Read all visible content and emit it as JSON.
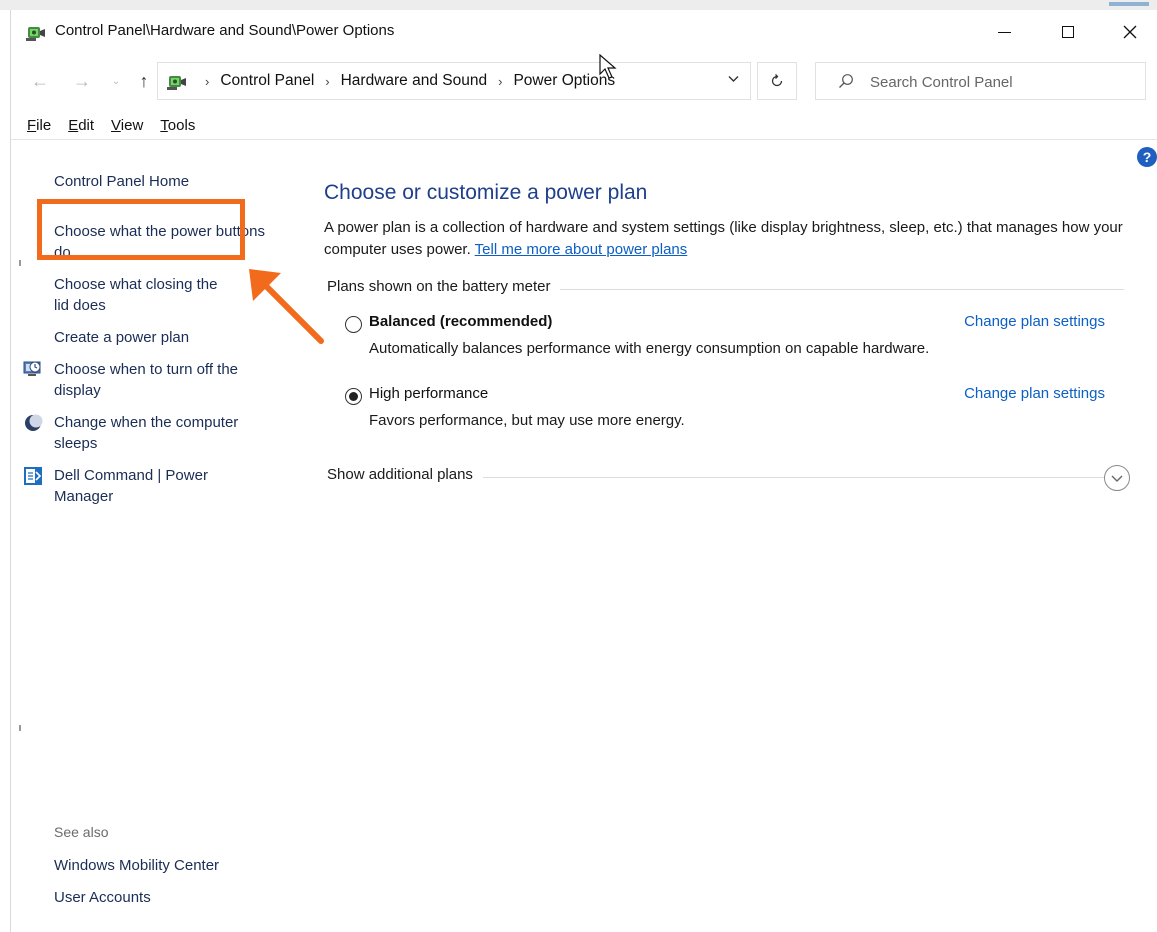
{
  "window": {
    "title": "Control Panel\\Hardware and Sound\\Power Options",
    "minimize_label": "Minimize",
    "maximize_label": "Maximize",
    "close_label": "Close"
  },
  "address": {
    "crumbs": [
      "Control Panel",
      "Hardware and Sound",
      "Power Options"
    ],
    "search_placeholder": "Search Control Panel"
  },
  "menu": {
    "items": [
      {
        "label": "File",
        "accel": "F",
        "rest": "ile"
      },
      {
        "label": "Edit",
        "accel": "E",
        "rest": "dit"
      },
      {
        "label": "View",
        "accel": "V",
        "rest": "iew"
      },
      {
        "label": "Tools",
        "accel": "T",
        "rest": "ools"
      }
    ]
  },
  "sidebar": {
    "home": "Control Panel Home",
    "links": [
      {
        "label": "Choose what the power buttons do",
        "icon": ""
      },
      {
        "label": "Choose what closing the lid does",
        "icon": ""
      },
      {
        "label": "Create a power plan",
        "icon": ""
      },
      {
        "label": "Choose when to turn off the display",
        "icon": "monitor-clock-icon"
      },
      {
        "label": "Change when the computer sleeps",
        "icon": "moon-icon"
      },
      {
        "label": "Dell Command | Power Manager",
        "icon": "dell-power-manager-icon"
      }
    ],
    "see_also_label": "See also",
    "see_also": [
      "Windows Mobility Center",
      "User Accounts"
    ]
  },
  "main": {
    "heading": "Choose or customize a power plan",
    "description": "A power plan is a collection of hardware and system settings (like display brightness, sleep, etc.) that manages how your computer uses power.",
    "description_link": "Tell me more about power plans",
    "group_label": "Plans shown on the battery meter",
    "plans": [
      {
        "name": "Balanced (recommended)",
        "description": "Automatically balances performance with energy consumption on capable hardware.",
        "link": "Change plan settings",
        "selected": false
      },
      {
        "name": "High performance",
        "description": "Favors performance, but may use more energy.",
        "link": "Change plan settings",
        "selected": true
      }
    ],
    "show_more": "Show additional plans",
    "help_glyph": "?"
  },
  "colors": {
    "accent_annotation": "#f26a1b",
    "link": "#0b5fc6",
    "heading": "#1e3f8c"
  }
}
